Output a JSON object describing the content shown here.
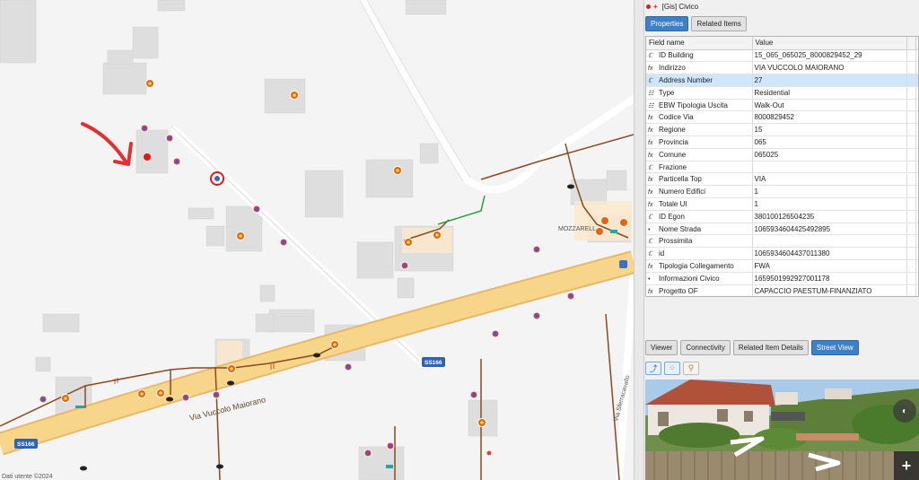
{
  "map": {
    "attribution": "Dati utente ©2024",
    "road_name": "Via Vuccolo Maiorano",
    "road_shield_1": "SS166",
    "road_shield_2": "SS166",
    "poi_label": "MOZZARELL",
    "side_road": "Via Sferracavallo"
  },
  "feature_panel": {
    "title": "[Gis] Civico",
    "tabs": [
      "Properties",
      "Related Items"
    ],
    "columns": {
      "field": "Field name",
      "value": "Value"
    },
    "rows": [
      {
        "icon": "abc",
        "field": "ID Building",
        "value": "15_065_065025_8000829452_29"
      },
      {
        "icon": "fx",
        "field": "Indirizzo",
        "value": "VIA VUCCOLO MAIORANO"
      },
      {
        "icon": "abc",
        "field": "Address Number",
        "value": "27"
      },
      {
        "icon": "list",
        "field": "Type",
        "value": "Residential"
      },
      {
        "icon": "list",
        "field": "EBW Tipologia Uscita",
        "value": "Walk-Out"
      },
      {
        "icon": "fx",
        "field": "Codice Via",
        "value": "8000829452"
      },
      {
        "icon": "fx",
        "field": "Regione",
        "value": "15"
      },
      {
        "icon": "fx",
        "field": "Provincia",
        "value": "065"
      },
      {
        "icon": "fx",
        "field": "Comune",
        "value": "065025"
      },
      {
        "icon": "abc",
        "field": "Frazione",
        "value": ""
      },
      {
        "icon": "fx",
        "field": "Particella Top",
        "value": "VIA"
      },
      {
        "icon": "fx",
        "field": "Numero Edifici",
        "value": "1"
      },
      {
        "icon": "fx",
        "field": "Totale UI",
        "value": "1"
      },
      {
        "icon": "abc",
        "field": "ID Egon",
        "value": "380100126504235"
      },
      {
        "icon": "dot",
        "field": "Nome Strada",
        "value": "1065934604425492895"
      },
      {
        "icon": "abc",
        "field": "Prossimita",
        "value": ""
      },
      {
        "icon": "abc",
        "field": "id",
        "value": "1065934604437011380"
      },
      {
        "icon": "fx",
        "field": "Tipologia Collegamento",
        "value": "FWA"
      },
      {
        "icon": "dot",
        "field": "Informazioni Civico",
        "value": "1659501992927001178"
      },
      {
        "icon": "fx",
        "field": "Progetto OF",
        "value": "CAPACCIO PAESTUM-FINANZIATO"
      }
    ],
    "selected_row": 2
  },
  "detail_panel": {
    "tabs": [
      "Viewer",
      "Connectivity",
      "Related Item Details",
      "Street View"
    ],
    "active_tab": 3
  },
  "colors": {
    "accent": "#3d80c6",
    "marker_red": "#d62020",
    "road_yellow": "#f7d58a",
    "cable_brown": "#8a4a1e"
  }
}
